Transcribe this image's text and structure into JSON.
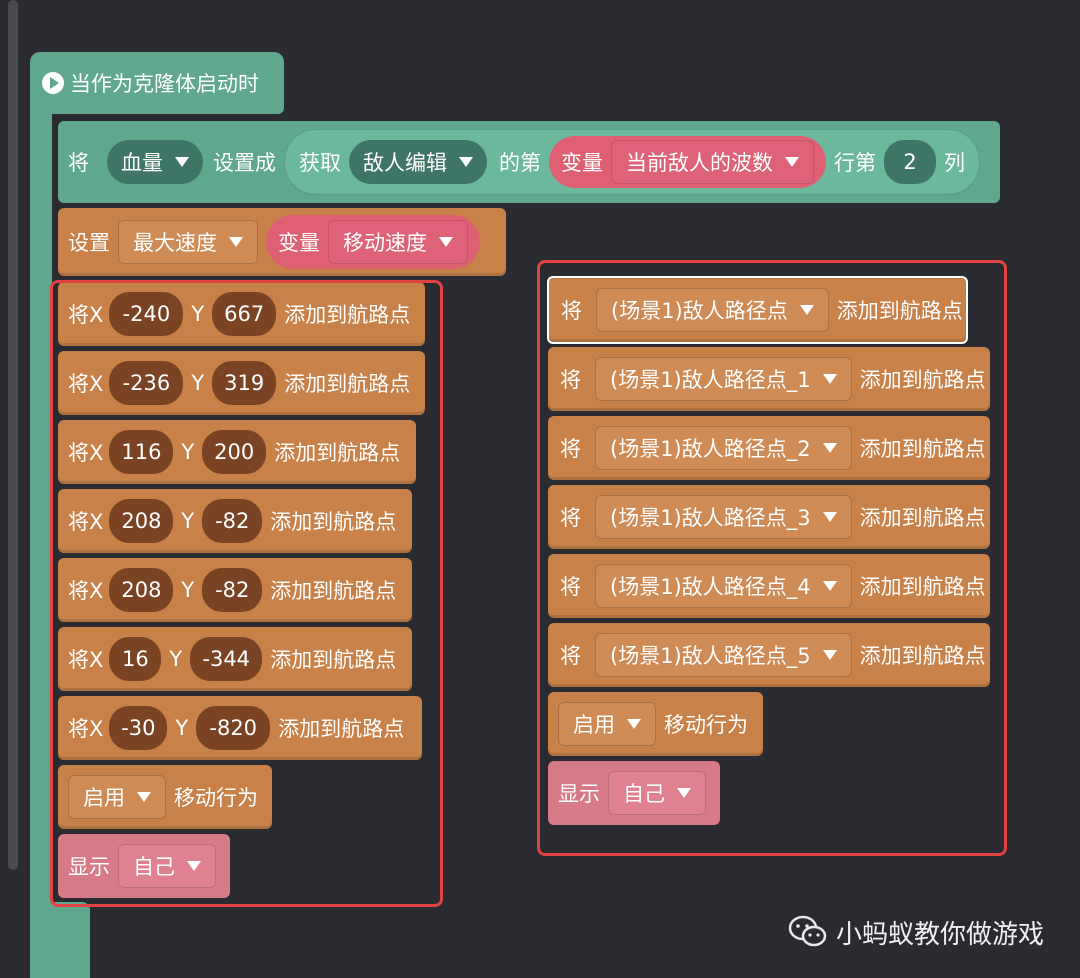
{
  "colors": {
    "background": "#2a2b30",
    "block_orange": "#c9814a",
    "block_green": "#5fa88e",
    "block_pink": "#d77a87",
    "highlight_red": "#e24242"
  },
  "hat": {
    "label": "当作为克隆体启动时",
    "icon": "play-icon"
  },
  "set_row": {
    "prefix": "将",
    "var": "血量",
    "set_to": "设置成",
    "get": "获取",
    "list": "敌人编辑",
    "of_nth": "的第",
    "variable": "变量",
    "wave_var": "当前敌人的波数",
    "row_nth": "行第",
    "col": "2",
    "col_suffix": "列"
  },
  "speed_row": {
    "set": "设置",
    "prop": "最大速度",
    "variable": "变量",
    "var": "移动速度"
  },
  "left_waypoints": [
    {
      "prefix": "将X",
      "x": "-240",
      "ylabel": "Y",
      "y": "667",
      "suffix": "添加到航路点"
    },
    {
      "prefix": "将X",
      "x": "-236",
      "ylabel": "Y",
      "y": "319",
      "suffix": "添加到航路点"
    },
    {
      "prefix": "将X",
      "x": "116",
      "ylabel": "Y",
      "y": "200",
      "suffix": "添加到航路点"
    },
    {
      "prefix": "将X",
      "x": "208",
      "ylabel": "Y",
      "y": "-82",
      "suffix": "添加到航路点"
    },
    {
      "prefix": "将X",
      "x": "208",
      "ylabel": "Y",
      "y": "-82",
      "suffix": "添加到航路点"
    },
    {
      "prefix": "将X",
      "x": "16",
      "ylabel": "Y",
      "y": "-344",
      "suffix": "添加到航路点"
    },
    {
      "prefix": "将X",
      "x": "-30",
      "ylabel": "Y",
      "y": "-820",
      "suffix": "添加到航路点"
    }
  ],
  "left_enable": {
    "value": "启用",
    "action": "移动行为"
  },
  "left_show": {
    "label": "显示",
    "value": "自己"
  },
  "right_waypoints": [
    {
      "prefix": "将",
      "point": "(场景1)敌人路径点",
      "suffix": "添加到航路点"
    },
    {
      "prefix": "将",
      "point": "(场景1)敌人路径点_1",
      "suffix": "添加到航路点"
    },
    {
      "prefix": "将",
      "point": "(场景1)敌人路径点_2",
      "suffix": "添加到航路点"
    },
    {
      "prefix": "将",
      "point": "(场景1)敌人路径点_3",
      "suffix": "添加到航路点"
    },
    {
      "prefix": "将",
      "point": "(场景1)敌人路径点_4",
      "suffix": "添加到航路点"
    },
    {
      "prefix": "将",
      "point": "(场景1)敌人路径点_5",
      "suffix": "添加到航路点"
    }
  ],
  "right_enable": {
    "value": "启用",
    "action": "移动行为"
  },
  "right_show": {
    "label": "显示",
    "value": "自己"
  },
  "watermark": {
    "icon": "wechat-icon",
    "text": "小蚂蚁教你做游戏"
  }
}
